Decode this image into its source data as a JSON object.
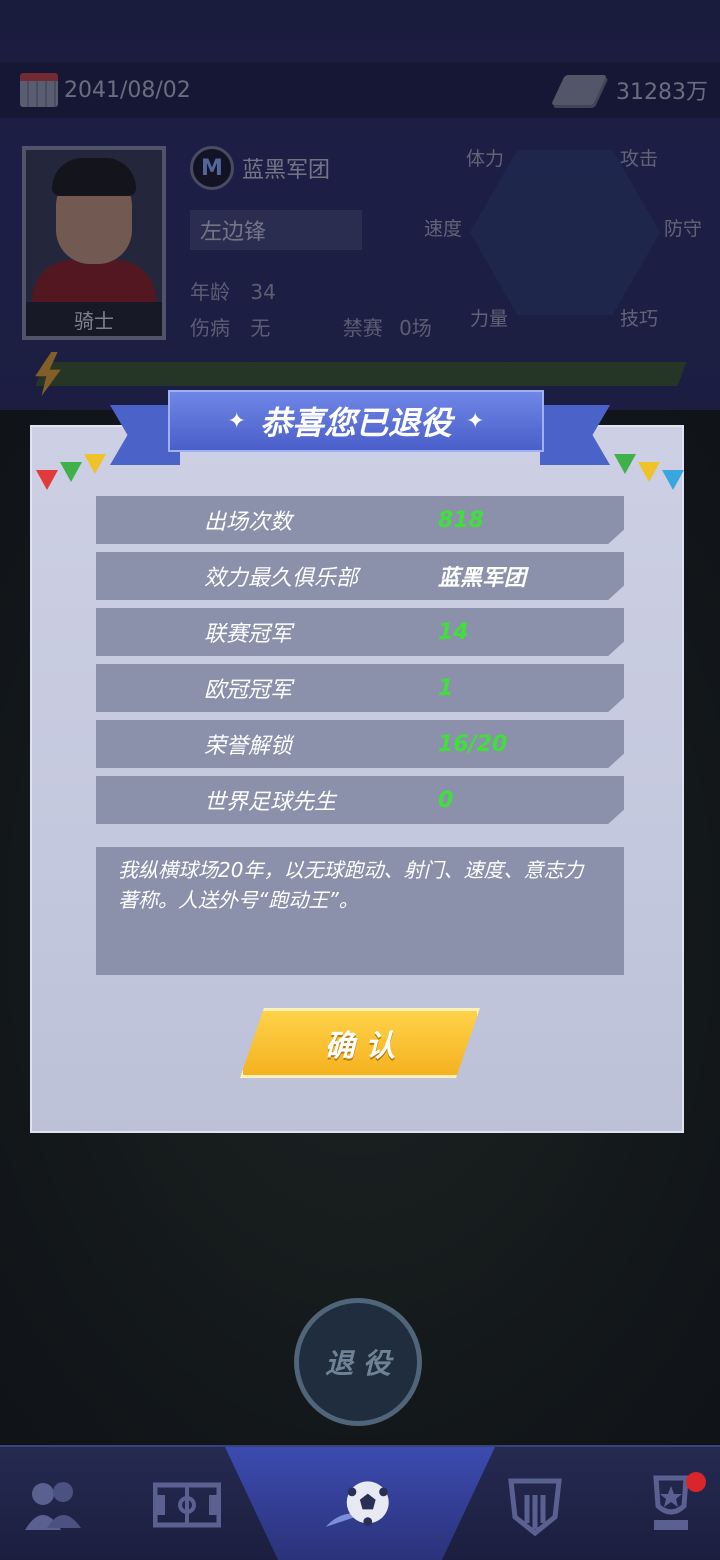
{
  "topbar": {
    "date": "2041/08/02",
    "money": "31283万",
    "date_icon": "calendar-icon",
    "money_icon": "cash-icon"
  },
  "player": {
    "role": "骑士",
    "club": "蓝黑军团",
    "position": "左边锋",
    "age_label": "年龄",
    "age": "34",
    "injury_label": "伤病",
    "injury": "无",
    "ban_label": "禁赛",
    "ban": "0场",
    "attributes": [
      "体力",
      "攻击",
      "速度",
      "防守",
      "力量",
      "技巧"
    ]
  },
  "modal": {
    "title": "恭喜您已退役",
    "stats": [
      {
        "label": "出场次数",
        "value": "818"
      },
      {
        "label": "效力最久俱乐部",
        "value": "蓝黑军团"
      },
      {
        "label": "联赛冠军",
        "value": "14"
      },
      {
        "label": "欧冠冠军",
        "value": "1"
      },
      {
        "label": "荣誉解锁",
        "value": "16/20"
      },
      {
        "label": "世界足球先生",
        "value": "0"
      }
    ],
    "bio": "我纵横球场20年，以无球跑动、射门、速度、意志力著称。人送外号“跑动王”。",
    "confirm": "确 认"
  },
  "retire_button": "退 役",
  "nav": {
    "items": [
      "team-icon",
      "pitch-icon",
      "football-icon",
      "club-badge-icon",
      "trophy-icon"
    ],
    "active": 2
  },
  "colors": {
    "accent_green": "#3fe03a",
    "banner_blue": "#4a5fc9",
    "confirm_gold": "#f5b21f"
  }
}
